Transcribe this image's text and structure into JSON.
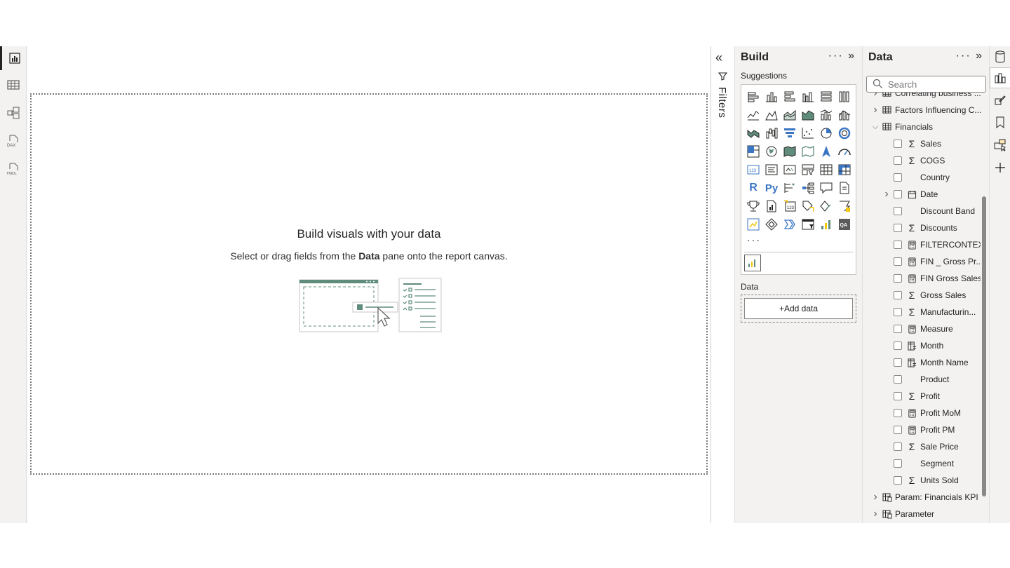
{
  "left_rail": {
    "items": [
      {
        "name": "report-view-icon",
        "active": true
      },
      {
        "name": "table-view-icon"
      },
      {
        "name": "model-view-icon"
      },
      {
        "name": "dax-query-icon",
        "label": "DAX"
      },
      {
        "name": "tmdl-view-icon",
        "label": "TMDL"
      }
    ]
  },
  "canvas": {
    "title": "Build visuals with your data",
    "subtitle_before": "Select or drag fields from the ",
    "subtitle_bold": "Data",
    "subtitle_after": " pane onto the report canvas."
  },
  "filters": {
    "collapse_glyph": "«",
    "label": "Filters"
  },
  "build": {
    "title": "Build",
    "tools": "··· »",
    "suggestions_label": "Suggestions",
    "more": "···",
    "data_label": "Data",
    "add_data": "+Add data",
    "visuals": [
      "stacked-bar-chart",
      "stacked-column-chart",
      "clustered-bar-chart",
      "clustered-column-chart",
      "100-stacked-bar-chart",
      "100-stacked-column-chart",
      "line-chart",
      "area-chart",
      "stacked-area-chart",
      "100-stacked-area-chart",
      "line-and-stacked-column-chart",
      "line-and-clustered-column-chart",
      "ribbon-chart",
      "waterfall-chart",
      "funnel-chart",
      "scatter-chart",
      "pie-chart",
      "donut-chart",
      "treemap",
      "map",
      "filled-map",
      "shape-map",
      "azure-map",
      "gauge",
      "card",
      "multi-row-card",
      "kpi",
      "slicer",
      "table",
      "matrix",
      "r-script-visual",
      "python-visual",
      "key-influencers",
      "decomposition-tree",
      "q-and-a",
      "smart-narrative",
      "metrics",
      "paginated-report",
      "card-new",
      "power-apps",
      "power-automate",
      "button-slicer",
      "azure-maps",
      "shape",
      "chevron",
      "table-calendar",
      "custom-chart",
      "qa-visual"
    ],
    "visual_glyphs": {
      "r-script-visual": "R",
      "python-visual": "Py",
      "qa-visual": "QA",
      "card": "123"
    }
  },
  "data_pane": {
    "title": "Data",
    "tools": "··· »",
    "search_placeholder": "Search",
    "tables": [
      {
        "label": "Correlating business ...",
        "expanded": false,
        "partial": true
      },
      {
        "label": "Factors Influencing C...",
        "expanded": false
      },
      {
        "label": "Financials",
        "expanded": true
      }
    ],
    "fields": [
      {
        "label": "Sales",
        "icon": "sigma"
      },
      {
        "label": "COGS",
        "icon": "sigma"
      },
      {
        "label": "Country",
        "icon": ""
      },
      {
        "label": "Date",
        "icon": "calendar",
        "expandable": true
      },
      {
        "label": "Discount Band",
        "icon": ""
      },
      {
        "label": "Discounts",
        "icon": "sigma"
      },
      {
        "label": "FILTERCONTEXT",
        "icon": "calculator"
      },
      {
        "label": "FIN _ Gross Pr...",
        "icon": "calculator"
      },
      {
        "label": "FIN Gross Sales",
        "icon": "calculator"
      },
      {
        "label": "Gross Sales",
        "icon": "sigma"
      },
      {
        "label": "Manufacturin...",
        "icon": "sigma"
      },
      {
        "label": "Measure",
        "icon": "calculator"
      },
      {
        "label": "Month",
        "icon": "calc-column"
      },
      {
        "label": "Month Name",
        "icon": "calc-column"
      },
      {
        "label": "Product",
        "icon": ""
      },
      {
        "label": "Profit",
        "icon": "sigma"
      },
      {
        "label": "Profit MoM",
        "icon": "calculator"
      },
      {
        "label": "Profit PM",
        "icon": "calculator"
      },
      {
        "label": "Sale Price",
        "icon": "sigma"
      },
      {
        "label": "Segment",
        "icon": ""
      },
      {
        "label": "Units Sold",
        "icon": "sigma"
      }
    ],
    "bottom_tables": [
      {
        "label": "Param: Financials KPI"
      },
      {
        "label": "Parameter"
      }
    ]
  },
  "right_rail": {
    "items": [
      "data-pane-icon",
      "build-visual-icon",
      "format-icon",
      "bookmark-icon",
      "selection-icon",
      "add-pane-icon"
    ]
  },
  "colors": {
    "accent_teal": "#5f8c7b",
    "accent_yellow": "#f2c811",
    "accent_blue": "#3b76c4"
  }
}
